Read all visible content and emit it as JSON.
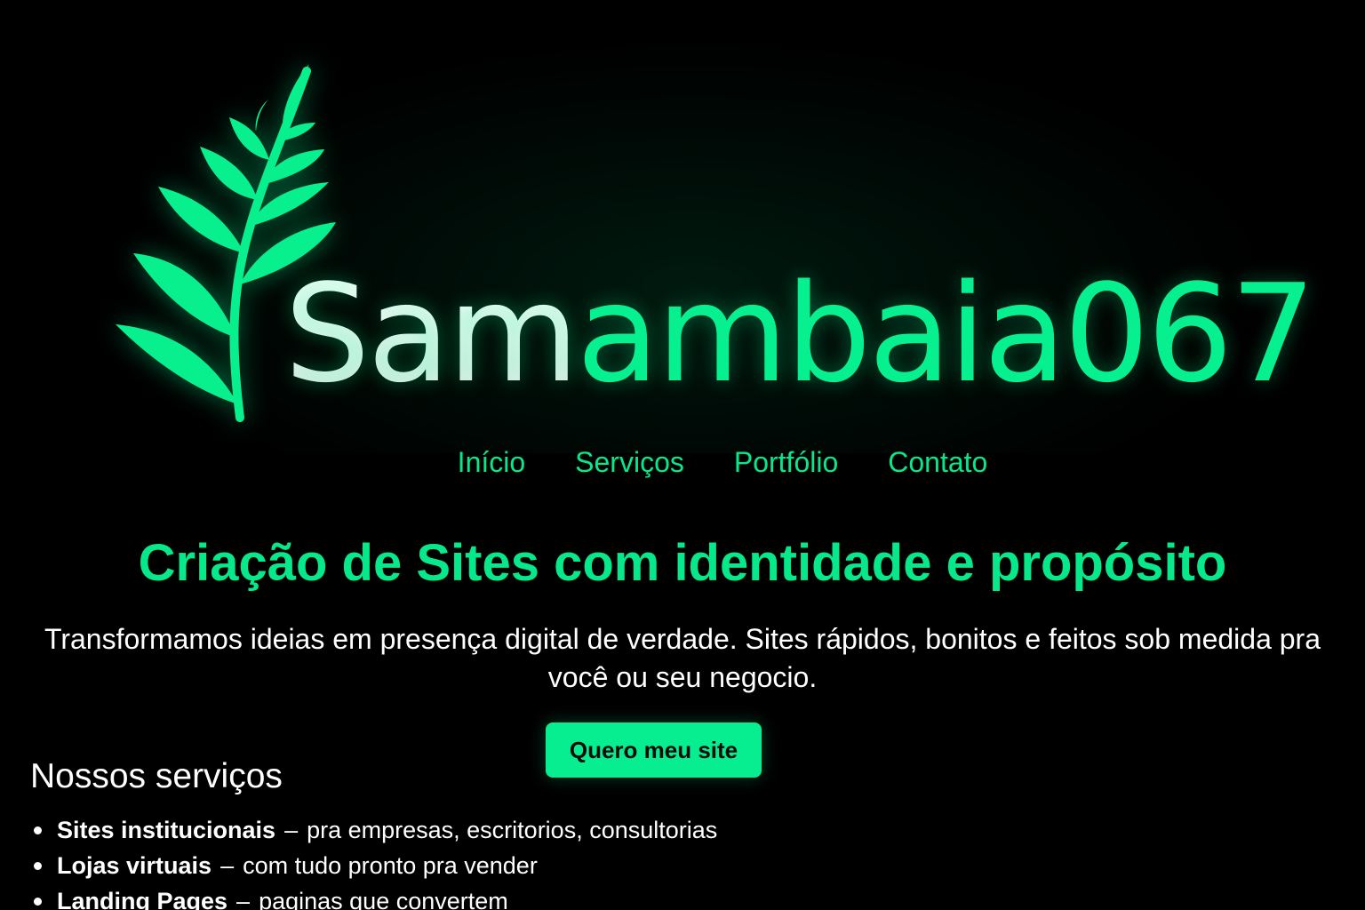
{
  "brand": {
    "name_part1": "Sam",
    "name_part2": "ambaia067",
    "accent_color": "#06f08f",
    "logo_icon": "fern-leaf-icon"
  },
  "nav": {
    "items": [
      {
        "label": "Início"
      },
      {
        "label": "Serviços"
      },
      {
        "label": "Portfólio"
      },
      {
        "label": "Contato"
      }
    ]
  },
  "hero": {
    "title": "Criação de Sites com identidade e propósito",
    "text": "Transformamos ideias em presença digital de verdade. Sites rápidos, bonitos e feitos sob medida pra você ou seu negocio.",
    "cta_label": "Quero meu site"
  },
  "services": {
    "title": "Nossos serviços",
    "separator": "–",
    "items": [
      {
        "name": "Sites institucionais",
        "description": "pra empresas, escritorios, consultorias"
      },
      {
        "name": "Lojas virtuais",
        "description": "com tudo pronto pra vender"
      },
      {
        "name": "Landing Pages",
        "description": "paginas que convertem"
      }
    ]
  },
  "colors": {
    "background": "#000000",
    "accent": "#06e88a",
    "text": "#ffffff"
  }
}
